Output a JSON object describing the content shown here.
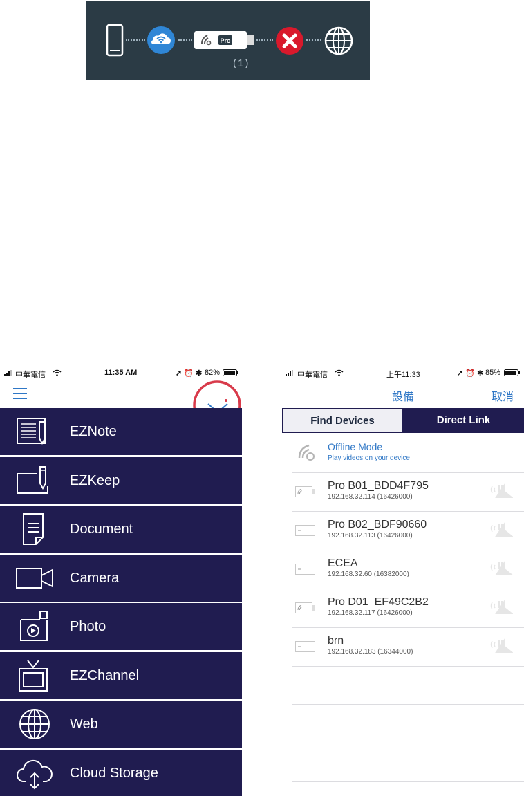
{
  "connection_bar": {
    "client_count": "(1)",
    "icons": [
      "phone-icon",
      "wifi-cloud-icon",
      "pro-dongle-icon",
      "error-icon",
      "globe-icon"
    ]
  },
  "left_screen": {
    "status": {
      "carrier": "中華電信",
      "time": "11:35 AM",
      "battery": "82%"
    },
    "nav": {
      "menu_icon": "hamburger-icon",
      "collapse_icon": "chevron-down-icon"
    },
    "menu": [
      {
        "label": "EZNote",
        "icon": "note-icon"
      },
      {
        "label": "EZKeep",
        "icon": "keep-icon"
      },
      {
        "label": "Document",
        "icon": "document-icon"
      },
      {
        "label": "Camera",
        "icon": "camera-icon"
      },
      {
        "label": "Photo",
        "icon": "photo-icon"
      },
      {
        "label": "EZChannel",
        "icon": "tv-icon"
      },
      {
        "label": "Web",
        "icon": "globe-icon"
      },
      {
        "label": "Cloud Storage",
        "icon": "cloud-icon"
      }
    ],
    "accent_color": "#201c50",
    "highlight_color": "#d83a4a"
  },
  "right_screen": {
    "status": {
      "carrier": "中華電信",
      "time": "上午11:33",
      "battery": "85%"
    },
    "nav": {
      "title": "設備",
      "cancel": "取消"
    },
    "tabs": {
      "find": "Find Devices",
      "direct": "Direct Link"
    },
    "offline": {
      "title": "Offline Mode",
      "subtitle": "Play videos on your device"
    },
    "devices": [
      {
        "name": "Pro B01_BDD4F795",
        "ip": "192.168.32.114 (16426000)",
        "type": "wifi"
      },
      {
        "name": "Pro B02_BDF90660",
        "ip": "192.168.32.113 (16426000)",
        "type": "plain"
      },
      {
        "name": "ECEA",
        "ip": "192.168.32.60 (16382000)",
        "type": "plain"
      },
      {
        "name": "Pro D01_EF49C2B2",
        "ip": "192.168.32.117 (16426000)",
        "type": "wifi"
      },
      {
        "name": "brn",
        "ip": "192.168.32.183 (16344000)",
        "type": "plain"
      }
    ],
    "link_color": "#2f77c6"
  }
}
